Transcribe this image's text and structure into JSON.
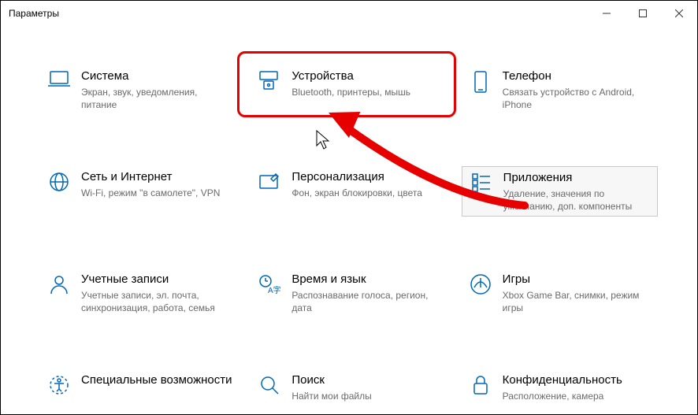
{
  "window_title": "Параметры",
  "accent_color": "#0067b8",
  "tiles": {
    "system": {
      "title": "Система",
      "sub": "Экран, звук, уведомления, питание",
      "icon": "laptop-icon"
    },
    "devices": {
      "title": "Устройства",
      "sub": "Bluetooth, принтеры, мышь",
      "icon": "devices-icon"
    },
    "phone": {
      "title": "Телефон",
      "sub": "Связать устройство с Android, iPhone",
      "icon": "phone-icon"
    },
    "network": {
      "title": "Сеть и Интернет",
      "sub": "Wi-Fi, режим \"в самолете\", VPN",
      "icon": "globe-icon"
    },
    "personalization": {
      "title": "Персонализация",
      "sub": "Фон, экран блокировки, цвета",
      "icon": "personalization-icon"
    },
    "apps": {
      "title": "Приложения",
      "sub": "Удаление, значения по умолчанию, доп. компоненты",
      "icon": "apps-icon"
    },
    "accounts": {
      "title": "Учетные записи",
      "sub": "Учетные записи, эл. почта, синхронизация, работа, семья",
      "icon": "accounts-icon"
    },
    "time": {
      "title": "Время и язык",
      "sub": "Распознавание голоса, регион, дата",
      "icon": "time-icon"
    },
    "gaming": {
      "title": "Игры",
      "sub": "Xbox Game Bar, снимки, режим игры",
      "icon": "gaming-icon"
    },
    "ease": {
      "title": "Специальные возможности",
      "sub": "",
      "icon": "ease-icon"
    },
    "search": {
      "title": "Поиск",
      "sub": "Найти мои файлы",
      "icon": "search-icon"
    },
    "privacy": {
      "title": "Конфиденциальность",
      "sub": "Расположение, камера",
      "icon": "privacy-icon"
    }
  }
}
